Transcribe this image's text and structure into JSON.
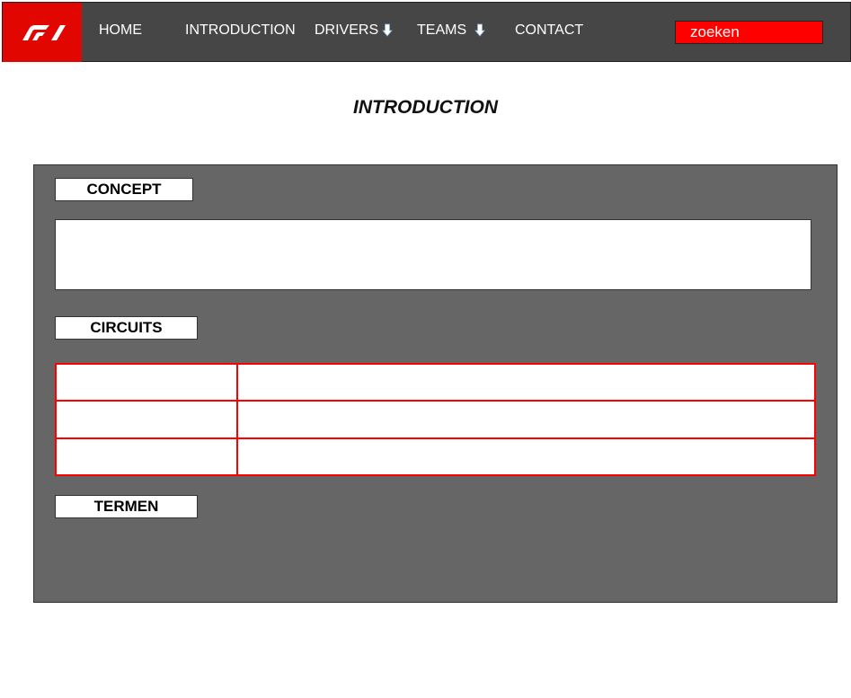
{
  "nav": {
    "logo_text": "F1",
    "items": [
      {
        "label": "HOME"
      },
      {
        "label": "INTRODUCTION"
      },
      {
        "label": "DRIVERS",
        "has_dropdown": true
      },
      {
        "label": "TEAMS",
        "has_dropdown": true
      },
      {
        "label": "CONTACT"
      }
    ],
    "search_placeholder": "zoeken"
  },
  "page": {
    "title": "INTRODUCTION"
  },
  "sections": {
    "concept": "CONCEPT",
    "circuits": "CIRCUITS",
    "termen": "TERMEN"
  },
  "circuits_table": {
    "rows": [
      [
        "",
        ""
      ],
      [
        "",
        ""
      ],
      [
        "",
        ""
      ]
    ]
  },
  "colors": {
    "nav_bg": "#464646",
    "logo_bg": "#e10600",
    "search_bg": "#ff0000",
    "panel_bg": "#666666",
    "table_border": "#ff0000"
  }
}
